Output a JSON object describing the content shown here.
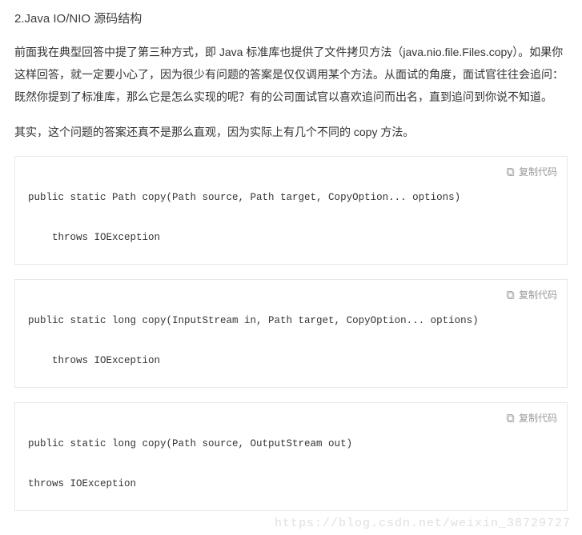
{
  "heading": "2.Java IO/NIO 源码结构",
  "para1": "前面我在典型回答中提了第三种方式，即 Java 标准库也提供了文件拷贝方法（java.nio.file.Files.copy）。如果你这样回答，就一定要小心了，因为很少有问题的答案是仅仅调用某个方法。从面试的角度，面试官往往会追问：既然你提到了标准库，那么它是怎么实现的呢？有的公司面试官以喜欢追问而出名，直到追问到你说不知道。",
  "para2": "其实，这个问题的答案还真不是那么直观，因为实际上有几个不同的 copy 方法。",
  "copy_label": "复制代码",
  "code_blocks": [
    "\npublic static Path copy(Path source, Path target, CopyOption... options)\n\n    throws IOException",
    "\npublic static long copy(InputStream in, Path target, CopyOption... options)\n\n    throws IOException",
    "\npublic static long copy(Path source, OutputStream out) \n\nthrows IOException"
  ],
  "watermark": "https://blog.csdn.net/weixin_38729727"
}
